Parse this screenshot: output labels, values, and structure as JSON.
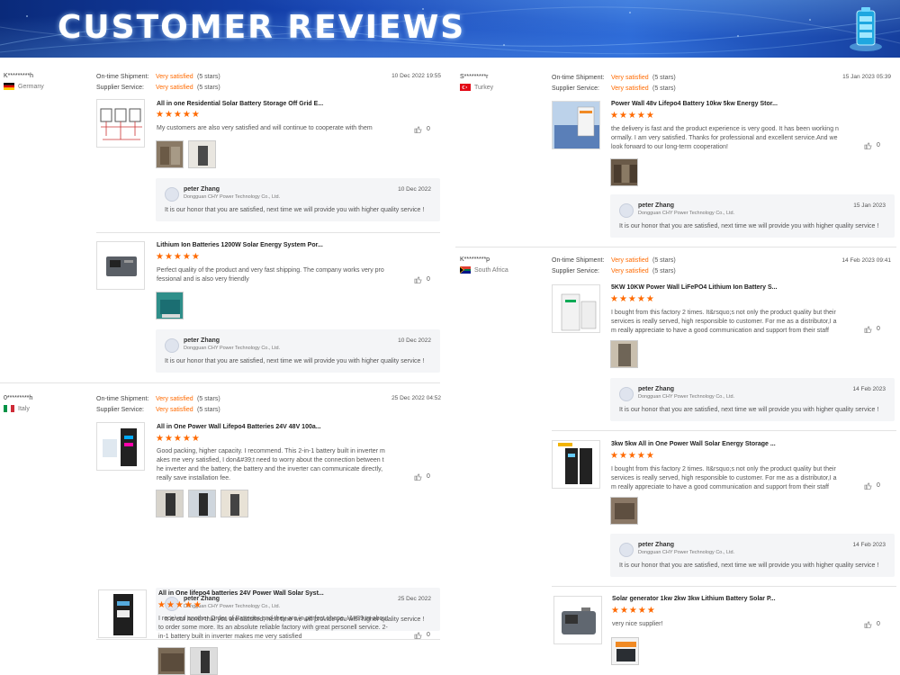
{
  "banner": {
    "title": "CUSTOMER REVIEWS"
  },
  "colors": {
    "accent": "#ff6a00",
    "banner": "#1746b8"
  },
  "labels": {
    "shipment": "On-time Shipment:",
    "service": "Supplier Service:",
    "satisfied": "Very satisfied",
    "five_stars": "(5 stars)"
  },
  "reply": {
    "name": "peter Zhang",
    "company": "Dongguan CHY Power Technology Co., Ltd.",
    "message": "It is our honor that you are satisfied, next time we will provide you with higher quality service !"
  },
  "stars": "★★★★★",
  "left": {
    "reviewers": [
      {
        "name": "K*********h",
        "country": "Germany",
        "date": "10 Dec 2022 19:55"
      },
      {
        "name": "0*********h",
        "country": "Italy",
        "date": "25 Dec 2022 04:52"
      }
    ],
    "reviews": [
      {
        "title": "All in one Residential Solar Battery Storage Off Grid E...",
        "text": "My customers are also very satisfied and will continue to cooperate with them",
        "likes": "0",
        "reply_date": "10 Dec 2022"
      },
      {
        "title": "Lithium Ion Batteries 1200W Solar Energy System Por...",
        "text": "Perfect quality of the product and very fast shipping. The company works very pro fessional and is also very friendly",
        "likes": "0",
        "reply_date": "10 Dec 2022"
      },
      {
        "title": "All in One Power Wall Lifepo4 Batteries 24V 48V 100a...",
        "text": "Good packing, higher capacity. I recommend. This 2-in-1 battery built in inverter m akes me very satisfied, I don&#39;t need to worry about the connection between t he inverter and the battery, the battery and the inverter can communicate directly, really save installation fee.",
        "likes": "0",
        "reply_date": "25 Dec 2022"
      },
      {
        "title": "All in One lifepo4 batteries 24V Power Wall Solar Syst...",
        "text": "I received another Order of Batteries and they are in perfect shape. I&#39;m about to order some more. Its an absolute reliable factory with great personell service. 2-in-1 battery built in inverter makes me very satisfied",
        "likes": "0"
      }
    ]
  },
  "right": {
    "reviewers": [
      {
        "name": "S*********r",
        "country": "Turkey",
        "date": "15 Jan 2023 05:39"
      },
      {
        "name": "K*********p",
        "country": "South Africa",
        "date": "14 Feb 2023 09:41"
      }
    ],
    "reviews": [
      {
        "title": "Power Wall 48v Lifepo4 Battery 10kw 5kw Energy Stor...",
        "text": "the delivery is fast and the product experience is very good. It has been working n ormally. I am very satisfied. Thanks for professional and excellent service.And we look forward to our long-term cooperation!",
        "likes": "0",
        "reply_date": "15 Jan 2023"
      },
      {
        "title": "5KW 10KW Power Wall LiFePO4 Lithium Ion Battery S...",
        "text": "I bought from this factory 2 times. It&rsquo;s not only the product quality but their services is really served, high responsible to customer. For me as a distributor,I a m really appreciate to have a good communication and support from their staff",
        "likes": "0",
        "reply_date": "14 Feb 2023"
      },
      {
        "title": "3kw 5kw All in One Power Wall Solar Energy Storage ...",
        "text": "I bought from this factory 2 times. It&rsquo;s not only the product quality but their services is really served, high responsible to customer. For me as a distributor,I a m really appreciate to have a good communication and support from their staff",
        "likes": "0",
        "reply_date": "14 Feb 2023"
      },
      {
        "title": "Solar generator 1kw 2kw 3kw Lithium Battery Solar P...",
        "text": "very nice supplier!",
        "likes": "0"
      }
    ]
  }
}
